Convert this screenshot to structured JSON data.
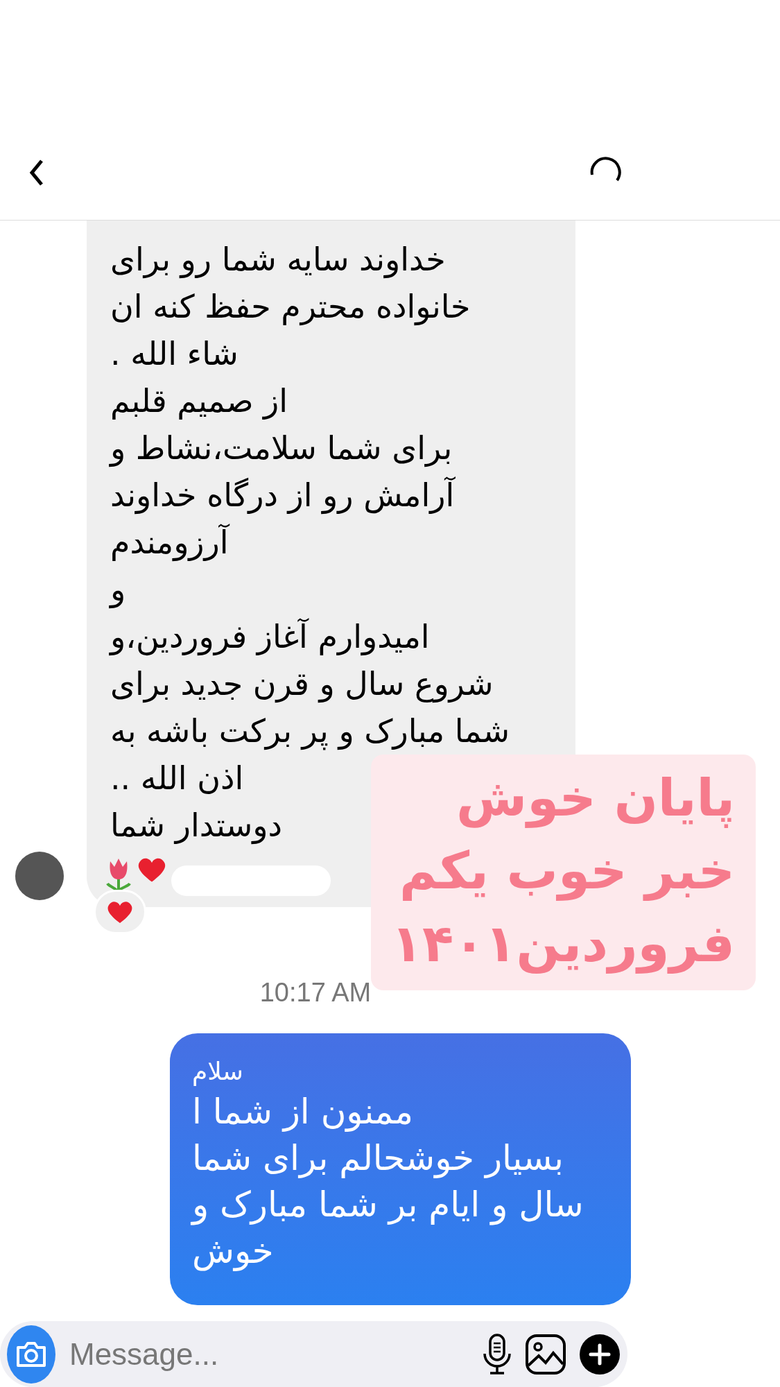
{
  "incoming_message": {
    "lines": [
      "خداوند سایه شما رو برای",
      "خانواده محترم حفظ کنه ان",
      "شاء الله .",
      "از صمیم قلبم",
      "برای شما سلامت،نشاط و",
      "آرامش رو از درگاه خداوند",
      "آرزومندم",
      "و",
      "امیدوارم آغاز فروردین،و",
      "شروع سال و قرن جدید برای",
      "شما مبارک و پر برکت باشه به",
      "اذن الله ..",
      "دوستدار شما"
    ]
  },
  "overlay_caption": {
    "lines": [
      "پایان خوش",
      "خبر خوب یکم",
      "فروردین۱۴۰۱"
    ]
  },
  "time": "10:17 AM",
  "outgoing_message": {
    "greeting": "سلام",
    "lines": [
      "ممنون از شما ا",
      "بسیار خوشحالم برای شما",
      "سال و ایام بر شما مبارک و",
      "خوش"
    ]
  },
  "composer": {
    "placeholder": "Message..."
  }
}
